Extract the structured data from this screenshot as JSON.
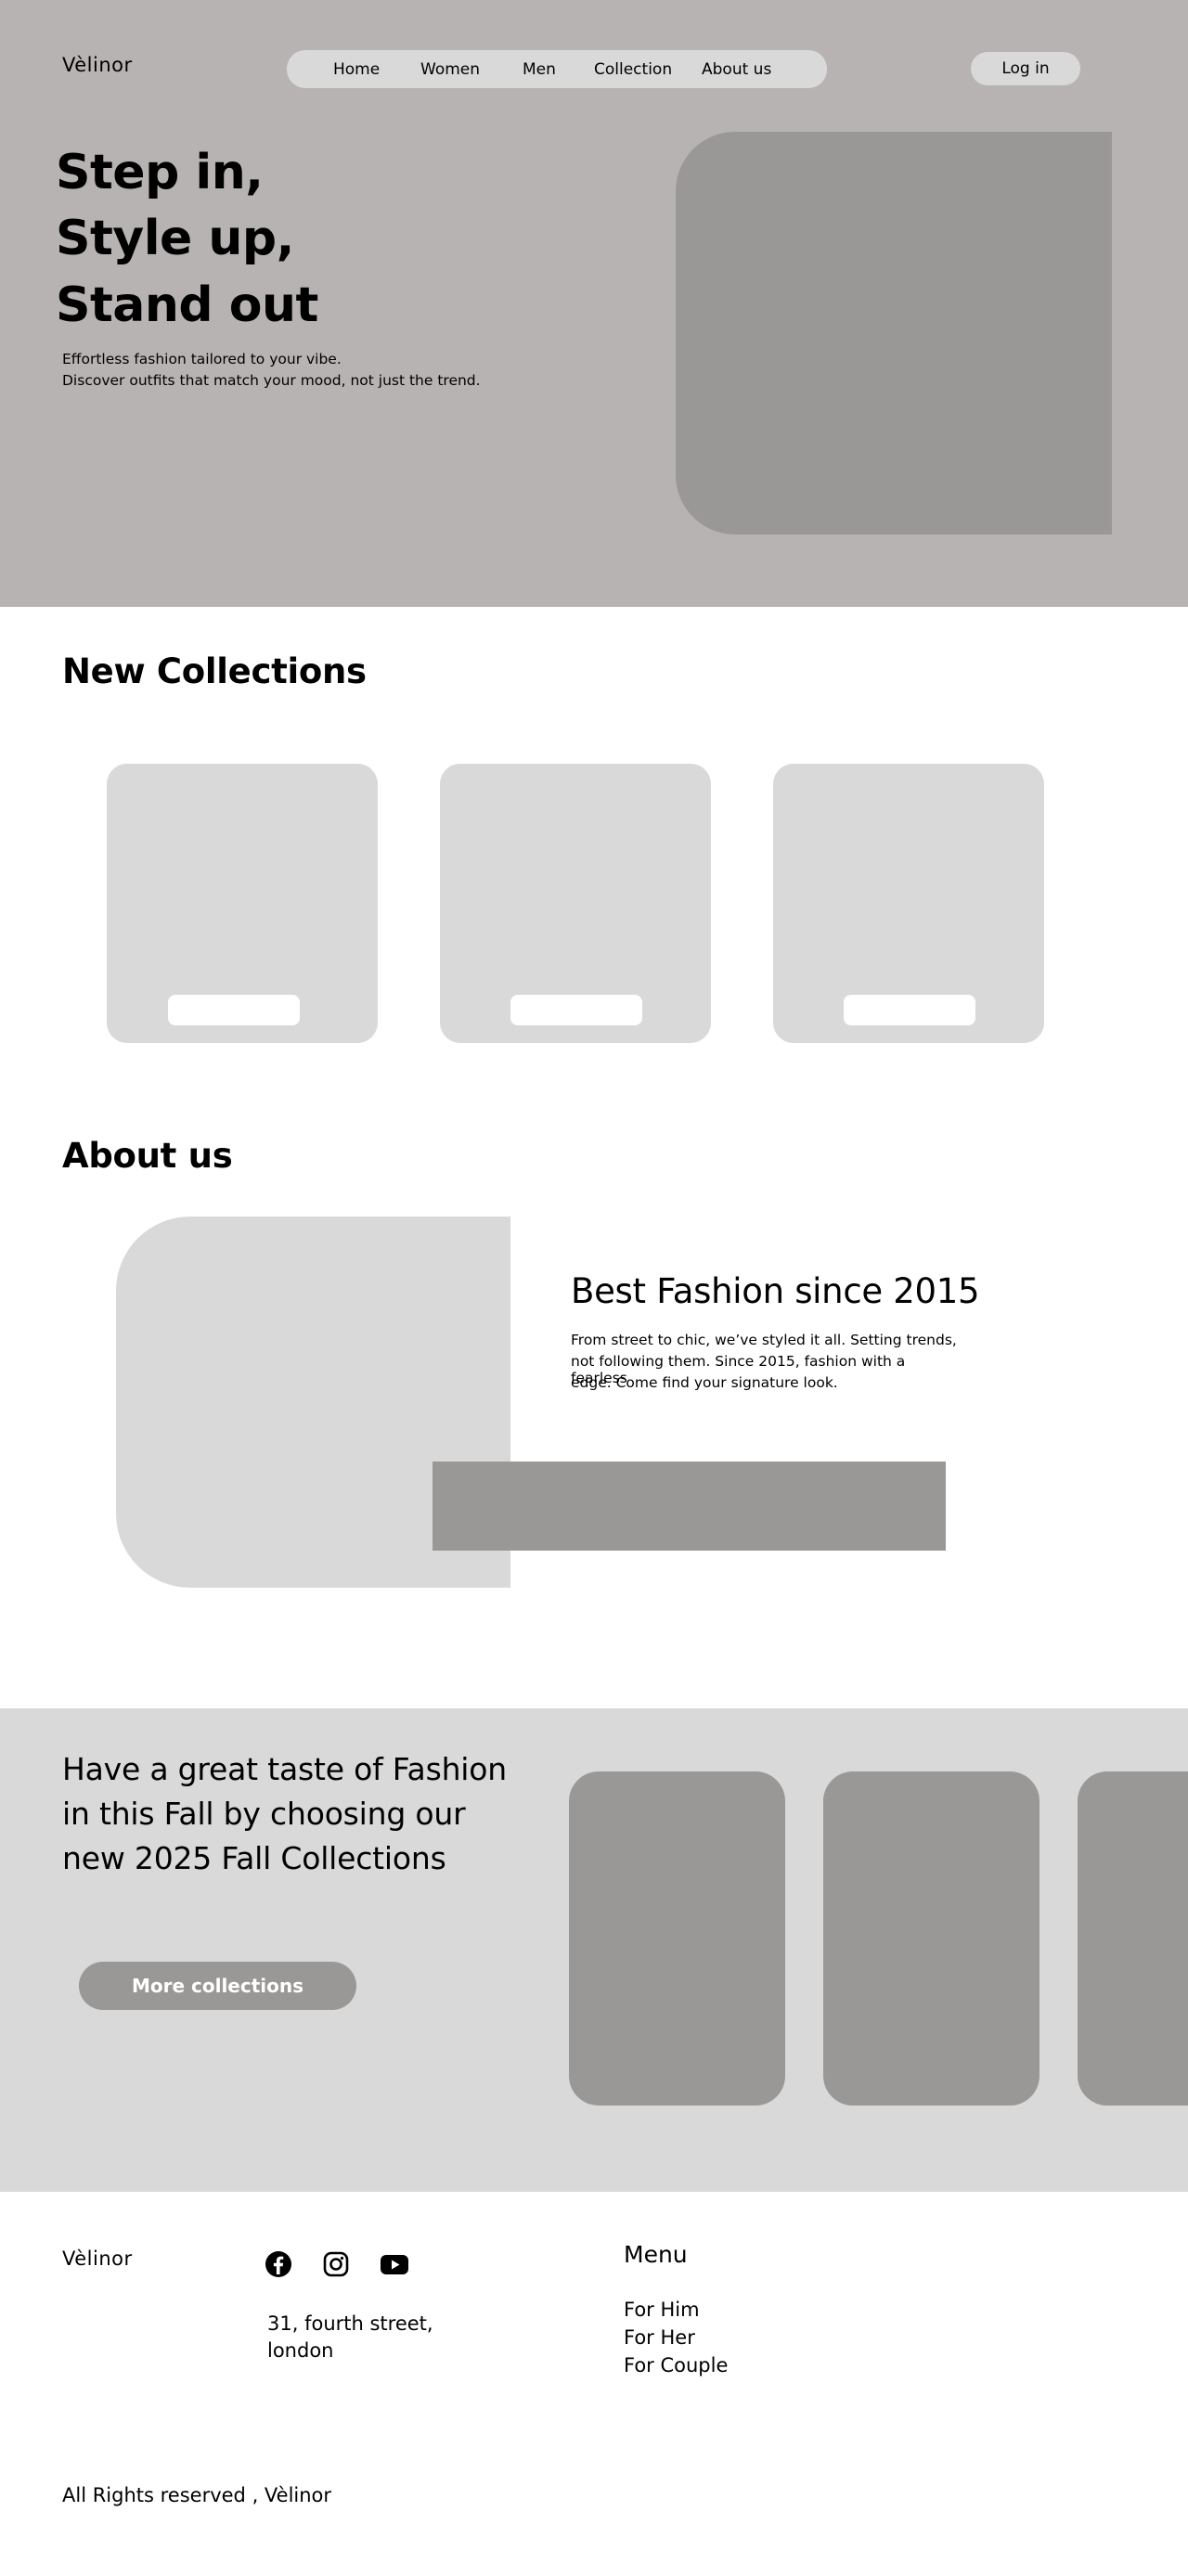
{
  "header": {
    "logo": "Vèlinor",
    "nav": [
      "Home",
      "Women",
      "Men",
      "Collection",
      "About us"
    ],
    "login_label": "Log in"
  },
  "hero": {
    "lines": [
      "Step in,",
      "Style up,",
      "Stand out"
    ],
    "subtitle": [
      "Effortless fashion tailored to your vibe.",
      "Discover outfits that match your mood, not just the trend."
    ]
  },
  "collections": {
    "title": "New Collections",
    "cards": 3
  },
  "about": {
    "title": "About us",
    "heading": "Best Fashion since 2015",
    "text": [
      "From street to chic, we’ve styled it all. Setting trends,",
      "not following them. Since 2015, fashion with a fearless",
      "edge. Come find your signature look."
    ]
  },
  "promo": {
    "lines": [
      "Have a great taste of Fashion",
      "in this Fall by choosing our",
      "new 2025 Fall Collections"
    ],
    "button_label": "More collections"
  },
  "footer": {
    "logo": "Vèlinor",
    "social_icons": [
      "facebook-icon",
      "instagram-icon",
      "youtube-icon"
    ],
    "address": [
      "31, fourth street,",
      "london"
    ],
    "menu_title": "Menu",
    "menu_items": [
      "For Him",
      "For Her",
      "For Couple"
    ],
    "copyright": "All Rights reserved , Vèlinor"
  },
  "colors": {
    "hero_bg": "#b8b3b3",
    "light_gray": "#d9d9d9",
    "mid_gray": "#999896",
    "white": "#ffffff",
    "text": "#000000"
  }
}
